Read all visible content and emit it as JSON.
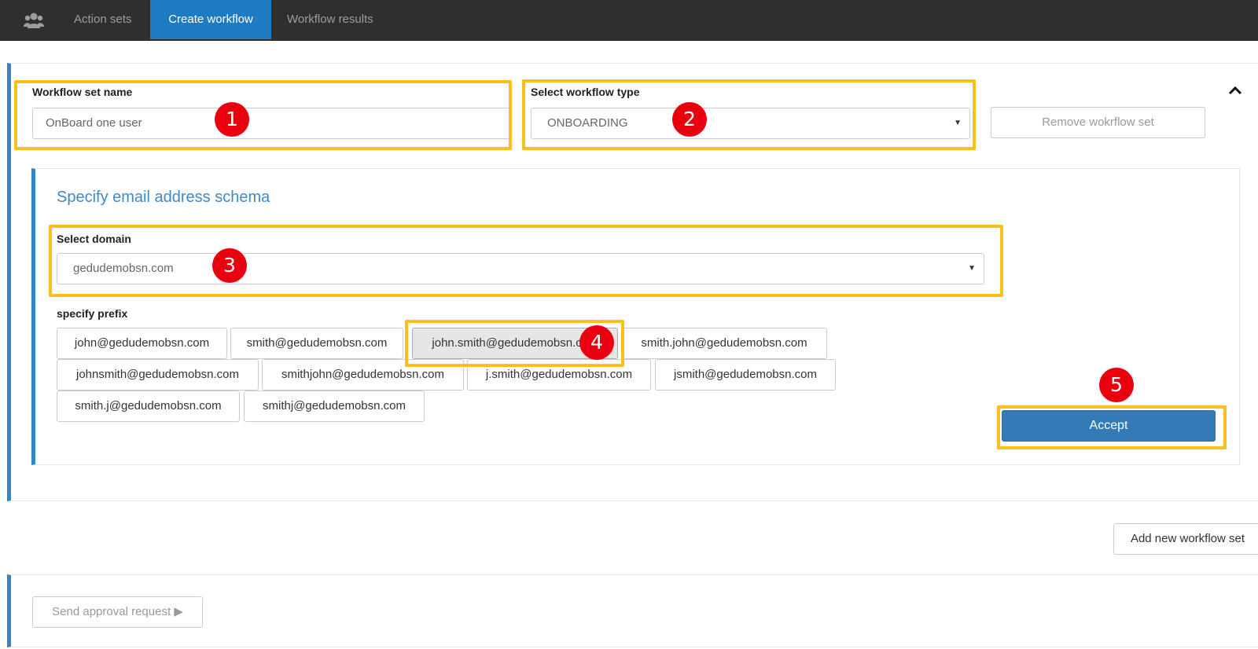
{
  "nav": {
    "tabs": [
      {
        "label": "Action sets"
      },
      {
        "label": "Create workflow",
        "active": true
      },
      {
        "label": "Workflow results"
      }
    ],
    "icon": "users-icon"
  },
  "workflow": {
    "name_label": "Workflow set name",
    "name_value": "OnBoard one user",
    "type_label": "Select workflow type",
    "type_value": "ONBOARDING",
    "remove_button": "Remove wokrflow set"
  },
  "email_schema": {
    "title": "Specify email address schema",
    "domain_label": "Select domain",
    "domain_value": "gedudemobsn.com",
    "prefix_label": "specify prefix",
    "prefixes": [
      "john@gedudemobsn.com",
      "smith@gedudemobsn.com",
      "john.smith@gedudemobsn.com",
      "smith.john@gedudemobsn.com",
      "johnsmith@gedudemobsn.com",
      "smithjohn@gedudemobsn.com",
      "j.smith@gedudemobsn.com",
      "jsmith@gedudemobsn.com",
      "smith.j@gedudemobsn.com",
      "smithj@gedudemobsn.com"
    ],
    "selected_prefix": "john.smith@gedudemobsn.com",
    "accept_button": "Accept"
  },
  "add_workflow_button": "Add new workflow set",
  "send_approval_button": "Send approval request ▶",
  "badges": [
    "1",
    "2",
    "3",
    "4",
    "5"
  ],
  "colors": {
    "nav_bg": "#2f2f2f",
    "nav_active": "#1f7bc1",
    "accent": "#3385c6",
    "highlight": "#fbbf1a",
    "badge": "#e8000f",
    "accept": "#337ab7"
  }
}
